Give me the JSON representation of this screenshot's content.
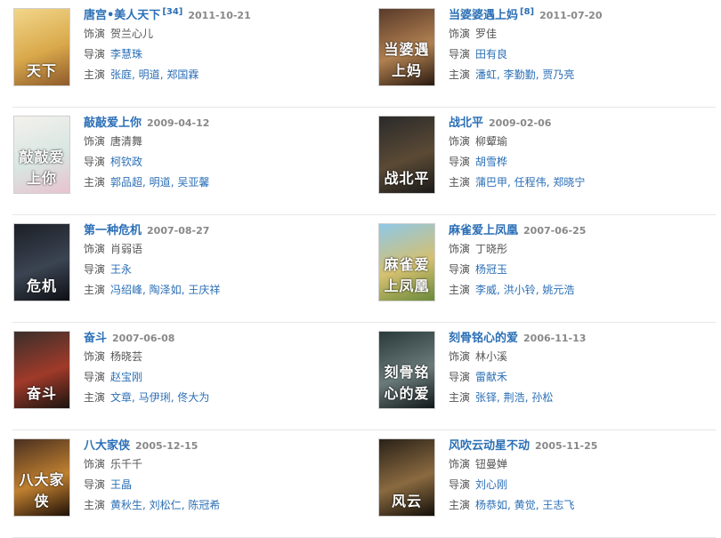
{
  "labels": {
    "role_actor": "饰演",
    "role_director": "导演",
    "role_star": "主演"
  },
  "items": [
    {
      "title": "唐宫•美人天下",
      "sup": "[34]",
      "date": "2011-10-21",
      "actor": [
        "贺兰心儿"
      ],
      "director": [
        "李慧珠"
      ],
      "stars": [
        "张庭",
        "明道",
        "郑国霖"
      ],
      "poster_text": "天下",
      "poster_colors": [
        "#f2d68a",
        "#d9a94b",
        "#8e5a2b"
      ]
    },
    {
      "title": "当婆婆遇上妈",
      "sup": "[8]",
      "date": "2011-07-20",
      "actor": [
        "罗佳"
      ],
      "director": [
        "田有良"
      ],
      "stars": [
        "潘虹",
        "李勤勤",
        "贾乃亮"
      ],
      "poster_text": "当婆遇上妈",
      "poster_colors": [
        "#5a3a2a",
        "#b08050",
        "#2a1a10"
      ]
    },
    {
      "title": "敲敲爱上你",
      "sup": "",
      "date": "2009-04-12",
      "actor": [
        "唐清舞"
      ],
      "director": [
        "柯钦政"
      ],
      "stars": [
        "郭品超",
        "明道",
        "吴亚馨"
      ],
      "poster_text": "敲敲爱上你",
      "poster_colors": [
        "#f4f1ec",
        "#d8e6e2",
        "#e8c2cf"
      ]
    },
    {
      "title": "战北平",
      "sup": "",
      "date": "2009-02-06",
      "actor": [
        "柳颦瑜"
      ],
      "director": [
        "胡雪桦"
      ],
      "stars": [
        "蒲巴甲",
        "任程伟",
        "郑晓宁"
      ],
      "poster_text": "战北平",
      "poster_colors": [
        "#2a2a2a",
        "#5b4a35",
        "#1a1a1a"
      ]
    },
    {
      "title": "第一种危机",
      "sup": "",
      "date": "2007-08-27",
      "actor": [
        "肖弱语"
      ],
      "director": [
        "王永"
      ],
      "stars": [
        "冯绍峰",
        "陶泽如",
        "王庆祥"
      ],
      "poster_text": "危机",
      "poster_colors": [
        "#1c1f26",
        "#3b4452",
        "#0d0f14"
      ]
    },
    {
      "title": "麻雀爱上凤凰",
      "sup": "",
      "date": "2007-06-25",
      "actor": [
        "丁晓彤"
      ],
      "director": [
        "杨冠玉"
      ],
      "stars": [
        "李威",
        "洪小铃",
        "姚元浩"
      ],
      "poster_text": "麻雀爱上凤凰",
      "poster_colors": [
        "#8fc8e8",
        "#d4c070",
        "#6a8a3a"
      ]
    },
    {
      "title": "奋斗",
      "sup": "",
      "date": "2007-06-08",
      "actor": [
        "杨晓芸"
      ],
      "director": [
        "赵宝刚"
      ],
      "stars": [
        "文章",
        "马伊琍",
        "佟大为"
      ],
      "poster_text": "奋斗",
      "poster_colors": [
        "#3a2f2a",
        "#a03a2a",
        "#1a1410"
      ]
    },
    {
      "title": "刻骨铭心的爱",
      "sup": "",
      "date": "2006-11-13",
      "actor": [
        "林小溪"
      ],
      "director": [
        "雷献禾"
      ],
      "stars": [
        "张铎",
        "荆浩",
        "孙松"
      ],
      "poster_text": "刻骨铭心的爱",
      "poster_colors": [
        "#2a3a3a",
        "#6a7a7a",
        "#101818"
      ]
    },
    {
      "title": "八大家侠",
      "sup": "",
      "date": "2005-12-15",
      "actor": [
        "乐千千"
      ],
      "director": [
        "王晶"
      ],
      "stars": [
        "黄秋生",
        "刘松仁",
        "陈冠希"
      ],
      "poster_text": "八大家侠",
      "poster_colors": [
        "#4a3020",
        "#c08030",
        "#201008"
      ]
    },
    {
      "title": "风吹云动星不动",
      "sup": "",
      "date": "2005-11-25",
      "actor": [
        "钮曼婵"
      ],
      "director": [
        "刘心刚"
      ],
      "stars": [
        "杨恭如",
        "黄觉",
        "王志飞"
      ],
      "poster_text": "风云",
      "poster_colors": [
        "#2a2218",
        "#8a6a40",
        "#14100a"
      ]
    }
  ]
}
